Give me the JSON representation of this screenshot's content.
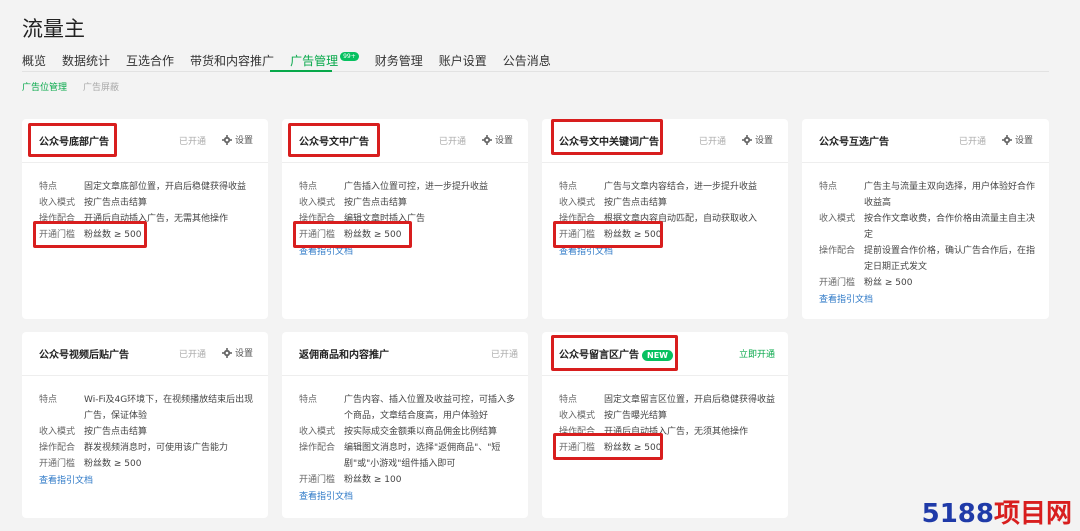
{
  "page_title": "流量主",
  "nav": [
    {
      "label": "概览"
    },
    {
      "label": "数据统计"
    },
    {
      "label": "互选合作"
    },
    {
      "label": "带货和内容推广"
    },
    {
      "label": "广告管理",
      "badge": "99+"
    },
    {
      "label": "财务管理"
    },
    {
      "label": "账户设置"
    },
    {
      "label": "公告消息"
    }
  ],
  "subnav": [
    {
      "label": "广告位管理"
    },
    {
      "label": "广告屏蔽"
    }
  ],
  "settings_label": "设置",
  "guide_label": "查看指引文档",
  "cards": [
    {
      "name": "公众号底部广告",
      "status": "已开通",
      "rows": [
        {
          "k": "特点",
          "v": "固定文章底部位置，开启后稳健获得收益"
        },
        {
          "k": "收入模式",
          "v": "按广告点击结算"
        },
        {
          "k": "操作配合",
          "v": "开通后自动插入广告，无需其他操作"
        },
        {
          "k": "开通门槛",
          "v": "粉丝数 ≥ 500"
        }
      ]
    },
    {
      "name": "公众号文中广告",
      "status": "已开通",
      "rows": [
        {
          "k": "特点",
          "v": "广告插入位置可控，进一步提升收益"
        },
        {
          "k": "收入模式",
          "v": "按广告点击结算"
        },
        {
          "k": "操作配合",
          "v": "编辑文章时插入广告"
        },
        {
          "k": "开通门槛",
          "v": "粉丝数 ≥ 500"
        }
      ]
    },
    {
      "name": "公众号文中关键词广告",
      "status": "已开通",
      "rows": [
        {
          "k": "特点",
          "v": "广告与文章内容结合，进一步提升收益"
        },
        {
          "k": "收入模式",
          "v": "按广告点击结算"
        },
        {
          "k": "操作配合",
          "v": "根据文章内容自动匹配，自动获取收入"
        },
        {
          "k": "开通门槛",
          "v": "粉丝数 ≥ 500"
        }
      ]
    },
    {
      "name": "公众号互选广告",
      "status": "已开通",
      "rows": [
        {
          "k": "特点",
          "v": "广告主与流量主双向选择，用户体验好合作收益高"
        },
        {
          "k": "收入模式",
          "v": "按合作文章收费，合作价格由流量主自主决定"
        },
        {
          "k": "操作配合",
          "v": "提前设置合作价格，确认广告合作后，在指定日期正式发文"
        },
        {
          "k": "开通门槛",
          "v": "粉丝 ≥ 500"
        }
      ]
    },
    {
      "name": "公众号视频后贴广告",
      "status": "已开通",
      "rows": [
        {
          "k": "特点",
          "v": "Wi-Fi及4G环境下，在视频播放结束后出现广告，保证体验"
        },
        {
          "k": "收入模式",
          "v": "按广告点击结算"
        },
        {
          "k": "操作配合",
          "v": "群发视频消息时，可使用该广告能力"
        },
        {
          "k": "开通门槛",
          "v": "粉丝数 ≥ 500"
        }
      ]
    },
    {
      "name": "返佣商品和内容推广",
      "status": "已开通",
      "rows": [
        {
          "k": "特点",
          "v": "广告内容、插入位置及收益可控，可插入多个商品，文章结合度高，用户体验好"
        },
        {
          "k": "收入模式",
          "v": "按实际成交金额乘以商品佣金比例结算"
        },
        {
          "k": "操作配合",
          "v": "编辑图文消息时，选择\"返佣商品\"、\"短剧\"或\"小游戏\"组件插入即可"
        },
        {
          "k": "开通门槛",
          "v": "粉丝数 ≥ 100"
        }
      ]
    },
    {
      "name": "公众号留言区广告",
      "badge": "NEW",
      "status": "立即开通",
      "rows": [
        {
          "k": "特点",
          "v": "固定文章留言区位置，开启后稳健获得收益"
        },
        {
          "k": "收入模式",
          "v": "按广告曝光结算"
        },
        {
          "k": "操作配合",
          "v": "开通后自动插入广告，无须其他操作"
        },
        {
          "k": "开通门槛",
          "v": "粉丝数 ≥ 500"
        }
      ]
    }
  ],
  "watermark": {
    "left": "5188",
    "right": "项目网"
  },
  "colors": {
    "brand_green": "#07a84a",
    "link_blue": "#2e79c7",
    "highlight_red": "#d81e1e"
  }
}
